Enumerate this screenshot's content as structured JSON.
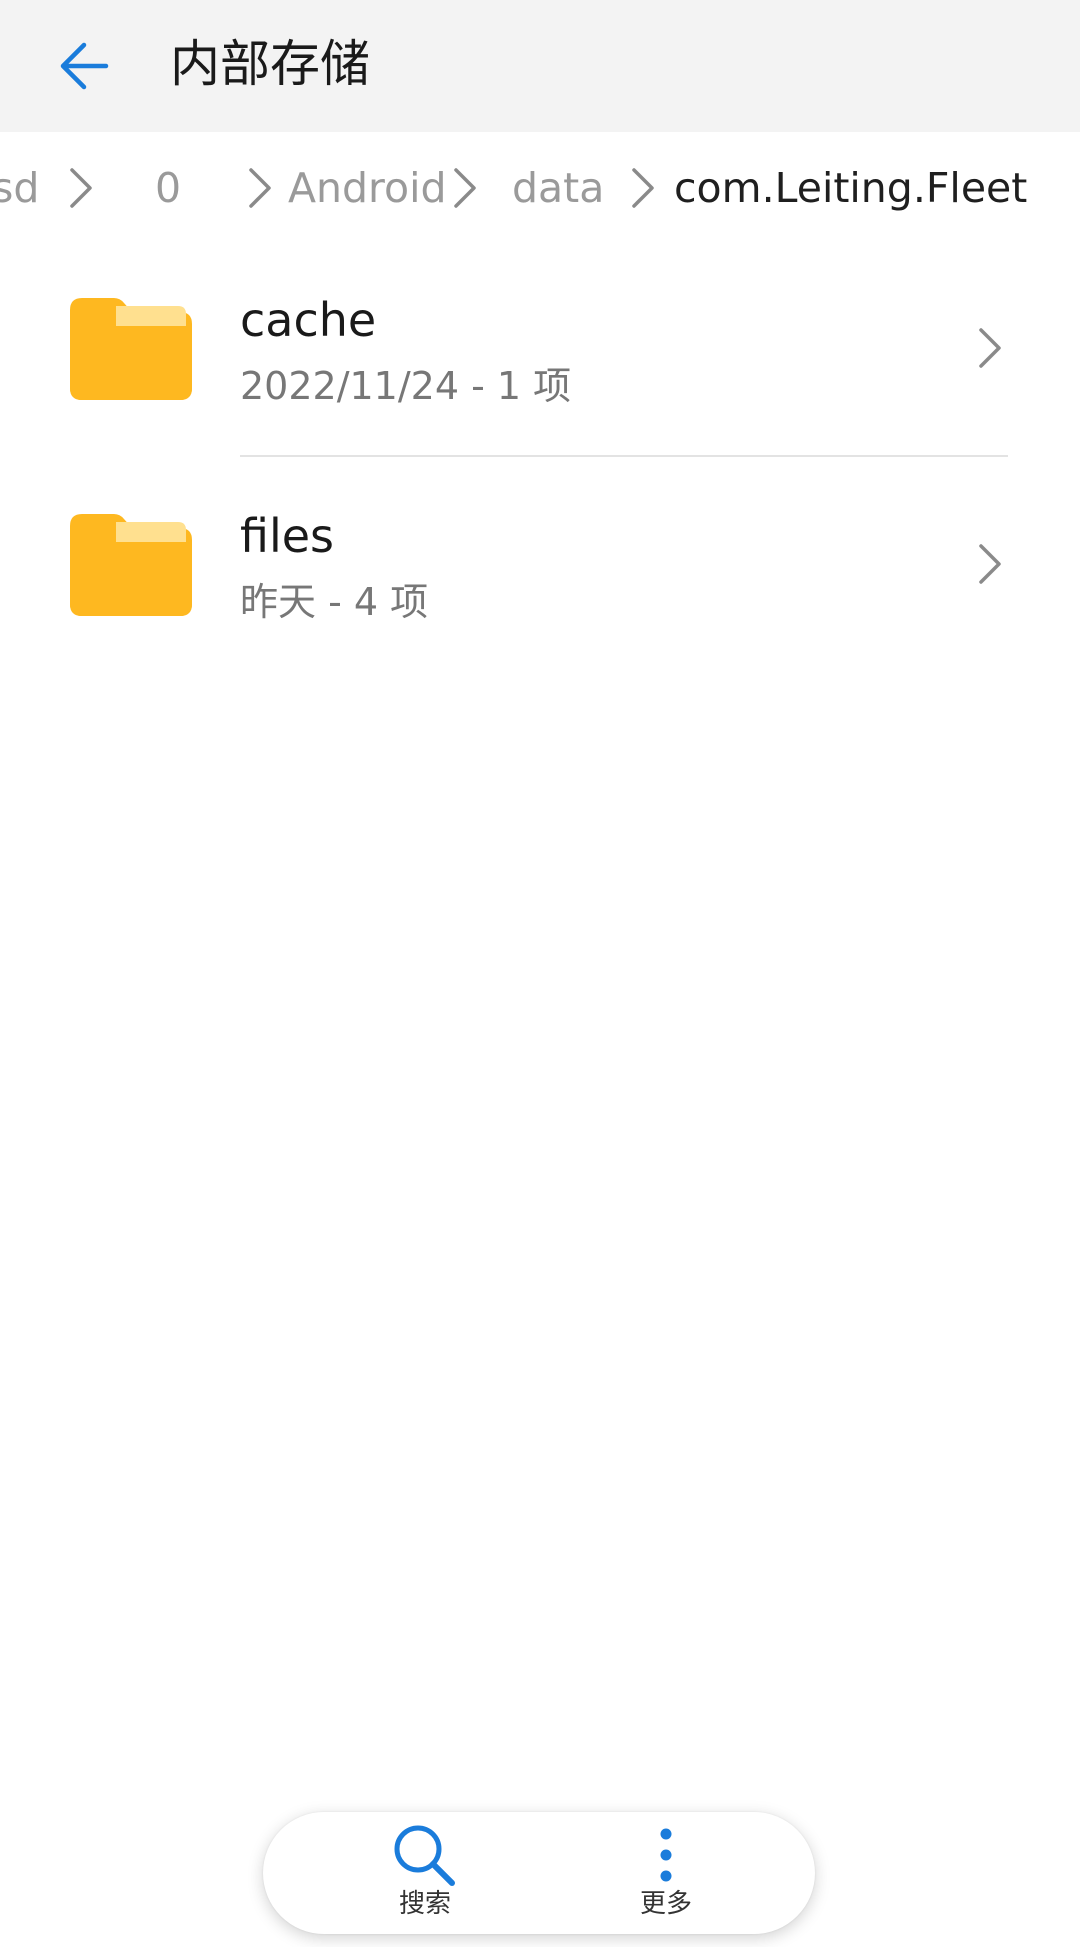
{
  "header": {
    "title": "内部存储",
    "back_icon": "arrow-left-icon",
    "accent_color": "#1a7cdb"
  },
  "breadcrumb": {
    "items": [
      "sd",
      "0",
      "Android",
      "data",
      "com.Leiting.Fleet"
    ],
    "separator_icon": "chevron-right-icon"
  },
  "files": [
    {
      "name": "cache",
      "meta": "2022/11/24 - 1 项",
      "icon": "folder-icon"
    },
    {
      "name": "files",
      "meta": "昨天 - 4 项",
      "icon": "folder-icon"
    }
  ],
  "toolbar": {
    "search_label": "搜索",
    "search_icon": "search-icon",
    "more_label": "更多",
    "more_icon": "more-vertical-icon"
  },
  "colors": {
    "folder": "#FEB820",
    "folder_tab": "#FFE08F",
    "header_bg": "#f3f3f3",
    "accent": "#1a7cdb"
  }
}
